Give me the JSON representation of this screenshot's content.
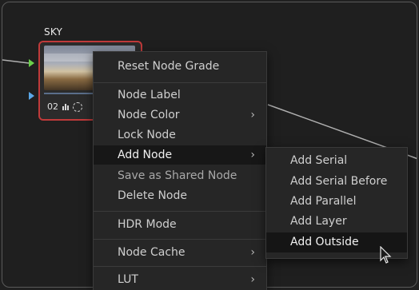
{
  "node": {
    "title": "SKY",
    "number": "02",
    "status_icons": [
      "histogram-icon",
      "cache-icon"
    ],
    "border_color": "#c03a3a"
  },
  "context_menu": {
    "items": [
      {
        "label": "Reset Node Grade"
      },
      {
        "label": "Node Label"
      },
      {
        "label": "Node Color",
        "has_submenu": true
      },
      {
        "label": "Lock Node"
      },
      {
        "label": "Add Node",
        "has_submenu": true,
        "highlighted": true
      },
      {
        "label": "Save as Shared Node"
      },
      {
        "label": "Delete Node"
      },
      {
        "label": "HDR Mode"
      },
      {
        "label": "Node Cache",
        "has_submenu": true
      },
      {
        "label": "LUT",
        "has_submenu": true
      }
    ],
    "submenu_arrow": "›"
  },
  "add_node_submenu": {
    "items": [
      {
        "label": "Add Serial"
      },
      {
        "label": "Add Serial Before"
      },
      {
        "label": "Add Parallel"
      },
      {
        "label": "Add Layer"
      },
      {
        "label": "Add Outside",
        "highlighted": true
      }
    ]
  },
  "colors": {
    "menu_bg": "#262626",
    "highlight_bg": "#171717",
    "input_green": "#6ad04a",
    "input_blue": "#5aa8e8"
  }
}
